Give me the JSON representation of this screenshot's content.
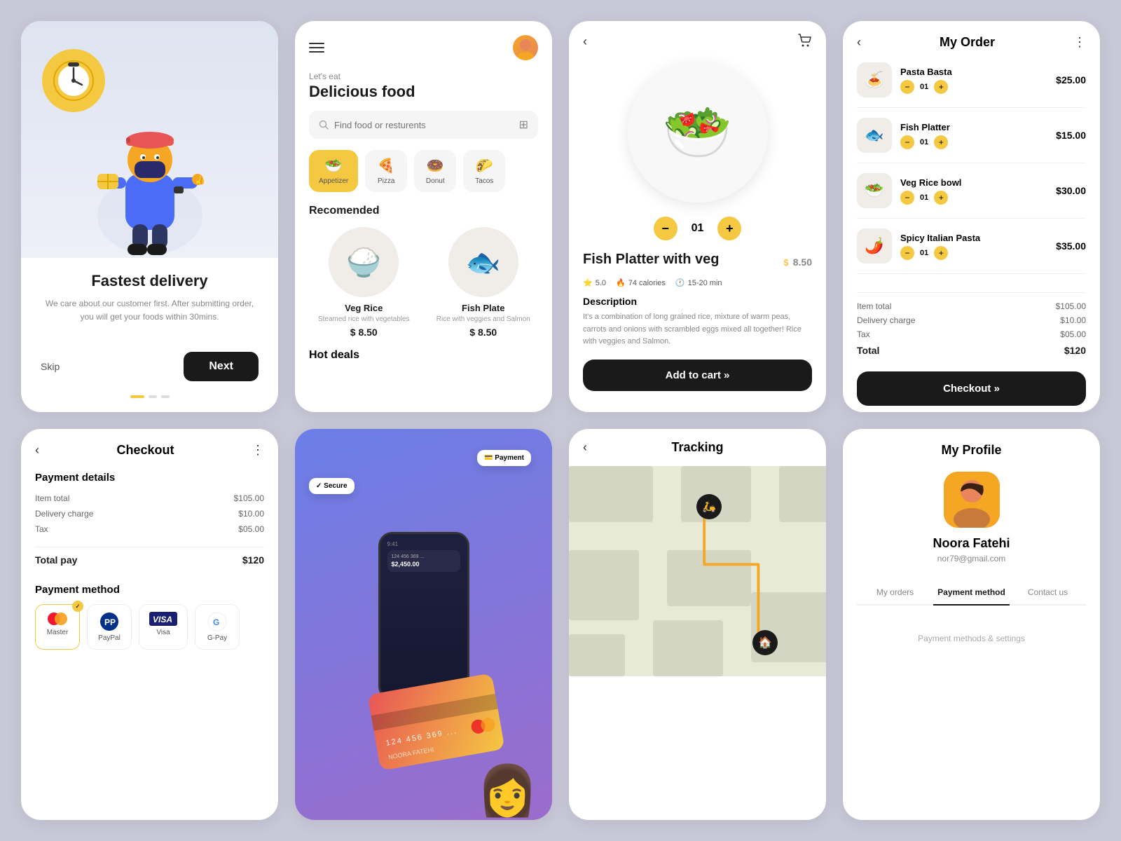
{
  "card1": {
    "title": "Fastest delivery",
    "subtitle": "We care about our customer first. After submitting order, you will get your foods within 30mins.",
    "skip_label": "Skip",
    "next_label": "Next",
    "dots": [
      true,
      false,
      false
    ]
  },
  "card2": {
    "greeting": "Let's eat",
    "heading": "Delicious food",
    "search_placeholder": "Find food or resturents",
    "categories": [
      {
        "name": "Appetizer",
        "icon": "🥗",
        "active": true
      },
      {
        "name": "Pizza",
        "icon": "🍕",
        "active": false
      },
      {
        "name": "Donut",
        "icon": "🍩",
        "active": false
      },
      {
        "name": "Tacos",
        "icon": "🌮",
        "active": false
      }
    ],
    "recommended_title": "Recomended",
    "foods": [
      {
        "name": "Veg Rice",
        "desc": "Steamed rice with vegetables",
        "price": "8.50",
        "icon": "🍚"
      },
      {
        "name": "Fish Plate",
        "desc": "Rice with veggies and Salmon",
        "price": "8.50",
        "icon": "🐟"
      }
    ],
    "hot_deals_title": "Hot deals"
  },
  "card3": {
    "dish_name": "Fish Platter with veg",
    "price": "8.50",
    "currency": "$",
    "rating": "5.0",
    "calories": "74 calories",
    "time": "15-20 min",
    "quantity": "01",
    "description_title": "Description",
    "description": "It's a combination of long grained rice, mixture of warm peas, carrots and onions with scrambled eggs mixed all together! Rice with veggies and Salmon.",
    "add_cart_label": "Add to cart »"
  },
  "card4": {
    "title": "My Order",
    "items": [
      {
        "name": "Pasta Basta",
        "qty": "01",
        "price": "$25.00",
        "icon": "🍝"
      },
      {
        "name": "Fish Platter",
        "qty": "01",
        "price": "$15.00",
        "icon": "🐟"
      },
      {
        "name": "Veg Rice bowl",
        "qty": "01",
        "price": "$30.00",
        "icon": "🥗"
      },
      {
        "name": "Spicy Italian Pasta",
        "qty": "01",
        "price": "$35.00",
        "icon": "🍝"
      }
    ],
    "item_total_label": "Item total",
    "item_total": "$105.00",
    "delivery_label": "Delivery charge",
    "delivery": "$10.00",
    "tax_label": "Tax",
    "tax": "$05.00",
    "total_label": "Total",
    "total": "$120",
    "checkout_label": "Checkout »"
  },
  "card5": {
    "title": "Checkout",
    "payment_details_title": "Payment details",
    "item_total_label": "Item total",
    "item_total": "$105.00",
    "delivery_label": "Delivery charge",
    "delivery": "$10.00",
    "tax_label": "Tax",
    "tax": "$05.00",
    "total_pay_label": "Total pay",
    "total_pay": "$120",
    "payment_method_title": "Payment method",
    "methods": [
      {
        "name": "Master",
        "active": true,
        "icon": "💳"
      },
      {
        "name": "PayPal",
        "active": false,
        "icon": "🅿"
      },
      {
        "name": "Visa",
        "active": false,
        "icon": "💳"
      },
      {
        "name": "G-Pay",
        "active": false,
        "icon": "G"
      }
    ]
  },
  "card6": {
    "card_number": "124 456 369 ..."
  },
  "card7": {
    "title": "Tracking"
  },
  "card8": {
    "title": "My Profile",
    "name": "Noora Fatehi",
    "email": "nor79@gmail.com",
    "tabs": [
      {
        "label": "My orders",
        "active": false
      },
      {
        "label": "Payment method",
        "active": true
      },
      {
        "label": "Contact us",
        "active": false
      }
    ]
  }
}
